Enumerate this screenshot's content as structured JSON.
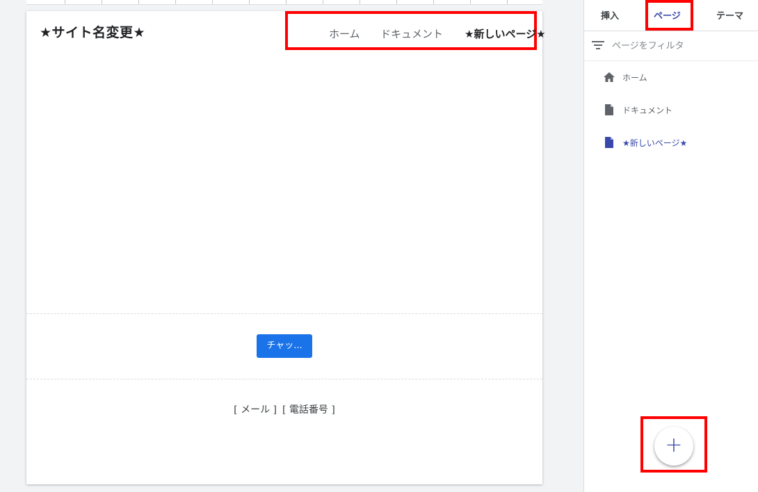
{
  "site": {
    "title": "★サイト名変更★",
    "nav": [
      {
        "label": "ホーム",
        "active": false
      },
      {
        "label": "ドキュメント",
        "active": false
      },
      {
        "label": "★新しいページ★",
        "active": true
      }
    ],
    "chat_button": "チャッ...",
    "footer": {
      "email": "[ メール ]",
      "phone": "[ 電話番号 ]"
    }
  },
  "sidebar": {
    "tabs": [
      {
        "label": "挿入",
        "active": false
      },
      {
        "label": "ページ",
        "active": true
      },
      {
        "label": "テーマ",
        "active": false
      }
    ],
    "filter": {
      "placeholder": "ページをフィルタ",
      "icon": "filter-icon"
    },
    "pages": [
      {
        "label": "ホーム",
        "icon": "home-icon",
        "active": false
      },
      {
        "label": "ドキュメント",
        "icon": "document-icon",
        "active": false
      },
      {
        "label": "★新しいページ★",
        "icon": "document-icon",
        "active": true
      }
    ],
    "fab": {
      "symbol": "+",
      "icon": "add-icon"
    }
  },
  "colors": {
    "accent": "#3949ab",
    "button": "#1a73e8",
    "highlight": "#ff0000"
  }
}
